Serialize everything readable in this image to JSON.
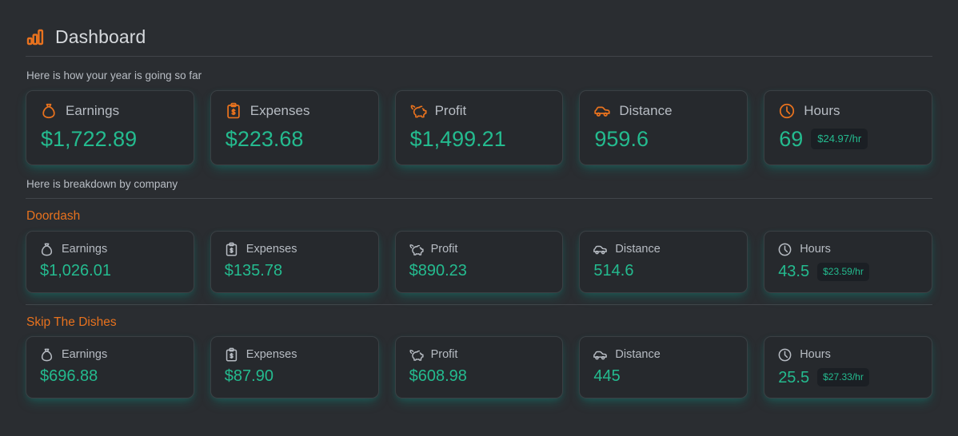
{
  "header": {
    "title": "Dashboard",
    "icon": "bar-chart-icon"
  },
  "theme": {
    "page_background": "#2a2d31",
    "card_background": "#26292d",
    "accent_orange": "#e8721e",
    "value_teal": "#24bb8f",
    "label_gray": "#b7bcc3",
    "badge_background": "#1b1f24",
    "glow": "#10867a"
  },
  "sections": [
    {
      "caption": "Here is how your year is going so far",
      "company": null,
      "cards": [
        {
          "icon": "money-bag-icon",
          "label": "Earnings",
          "value": "$1,722.89",
          "badge": null
        },
        {
          "icon": "clipboard-dollar-icon",
          "label": "Expenses",
          "value": "$223.68",
          "badge": null
        },
        {
          "icon": "piggy-bank-icon",
          "label": "Profit",
          "value": "$1,499.21",
          "badge": null
        },
        {
          "icon": "car-icon",
          "label": "Distance",
          "value": "959.6",
          "badge": null
        },
        {
          "icon": "clock-icon",
          "label": "Hours",
          "value": "69",
          "badge": "$24.97/hr"
        }
      ]
    },
    {
      "caption": "Here is breakdown by company",
      "company": "Doordash",
      "cards": [
        {
          "icon": "money-bag-icon",
          "label": "Earnings",
          "value": "$1,026.01",
          "badge": null
        },
        {
          "icon": "clipboard-dollar-icon",
          "label": "Expenses",
          "value": "$135.78",
          "badge": null
        },
        {
          "icon": "piggy-bank-icon",
          "label": "Profit",
          "value": "$890.23",
          "badge": null
        },
        {
          "icon": "car-icon",
          "label": "Distance",
          "value": "514.6",
          "badge": null
        },
        {
          "icon": "clock-icon",
          "label": "Hours",
          "value": "43.5",
          "badge": "$23.59/hr"
        }
      ]
    },
    {
      "caption": null,
      "company": "Skip The Dishes",
      "cards": [
        {
          "icon": "money-bag-icon",
          "label": "Earnings",
          "value": "$696.88",
          "badge": null
        },
        {
          "icon": "clipboard-dollar-icon",
          "label": "Expenses",
          "value": "$87.90",
          "badge": null
        },
        {
          "icon": "piggy-bank-icon",
          "label": "Profit",
          "value": "$608.98",
          "badge": null
        },
        {
          "icon": "car-icon",
          "label": "Distance",
          "value": "445",
          "badge": null
        },
        {
          "icon": "clock-icon",
          "label": "Hours",
          "value": "25.5",
          "badge": "$27.33/hr"
        }
      ]
    }
  ]
}
